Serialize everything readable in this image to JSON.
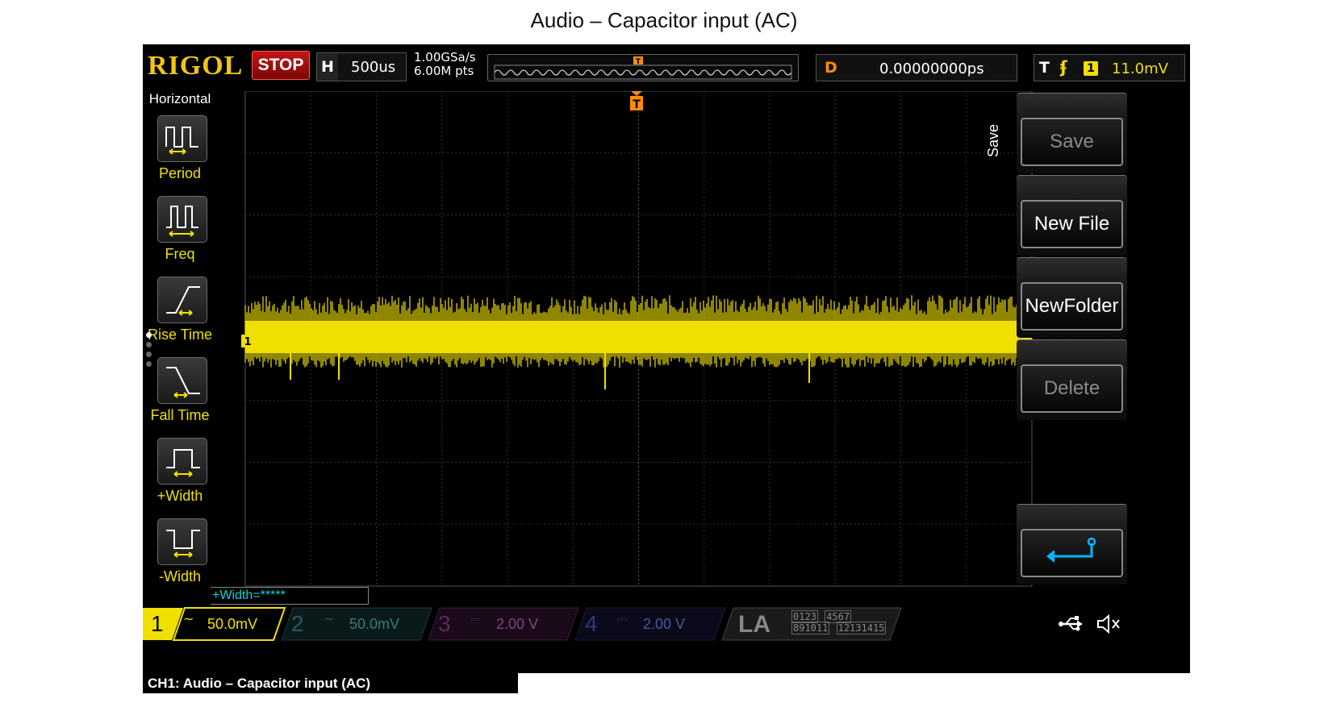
{
  "page_title": "Audio – Capacitor input (AC)",
  "scope": {
    "brand": "RIGOL",
    "run_state": "STOP",
    "horizontal": {
      "key": "H",
      "timebase": "500us"
    },
    "sample_rate": "1.00GSa/s",
    "memory_depth": "6.00M pts",
    "delay": {
      "key": "D",
      "value": "0.00000000ps"
    },
    "trigger": {
      "key": "T",
      "edge_icon": "rising-edge-icon",
      "channel": "1",
      "level": "11.0mV"
    }
  },
  "left_menu": {
    "title": "Horizontal",
    "items": [
      {
        "label": "Period",
        "icon": "period-icon"
      },
      {
        "label": "Freq",
        "icon": "freq-icon"
      },
      {
        "label": "Rise Time",
        "icon": "rise-time-icon"
      },
      {
        "label": "Fall Time",
        "icon": "fall-time-icon"
      },
      {
        "label": "+Width",
        "icon": "pos-width-icon"
      },
      {
        "label": "-Width",
        "icon": "neg-width-icon"
      }
    ]
  },
  "right_menu": {
    "tab": "Save",
    "buttons": [
      {
        "label": "Save",
        "enabled": false
      },
      {
        "label": "New File",
        "enabled": true
      },
      {
        "label": "NewFolder",
        "enabled": true
      },
      {
        "label": "Delete",
        "enabled": false
      }
    ],
    "back_icon": "return-arrow-icon"
  },
  "measurement_readout": "+Width=*****",
  "channels": [
    {
      "num": "1",
      "coupling_icon": "ac-coupling-icon",
      "scale": "50.0mV",
      "color": "#f0e000",
      "active": true
    },
    {
      "num": "2",
      "coupling_icon": "ac-coupling-icon",
      "scale": "50.0mV",
      "color": "#00c8d0",
      "active": false
    },
    {
      "num": "3",
      "coupling_icon": "dc-coupling-icon",
      "scale": "2.00 V",
      "color": "#d040c8",
      "active": false
    },
    {
      "num": "4",
      "coupling_icon": "dc-coupling-icon",
      "scale": "2.00 V",
      "color": "#3070ff",
      "active": false
    }
  ],
  "la": {
    "label": "LA",
    "row1": [
      "0123",
      "4567"
    ],
    "row2": [
      "891011",
      "12131415"
    ]
  },
  "status_icons": [
    "usb-icon",
    "speaker-mute-icon"
  ],
  "markers": {
    "ch1": "1",
    "trigger_pos": "T",
    "trigger_level": "T"
  },
  "footer_caption": "CH1: Audio – Capacitor input (AC)",
  "colors": {
    "brand": "#f0c419",
    "ch1": "#f0e000",
    "trigger": "#ff8c00",
    "stop": "#c41616"
  }
}
